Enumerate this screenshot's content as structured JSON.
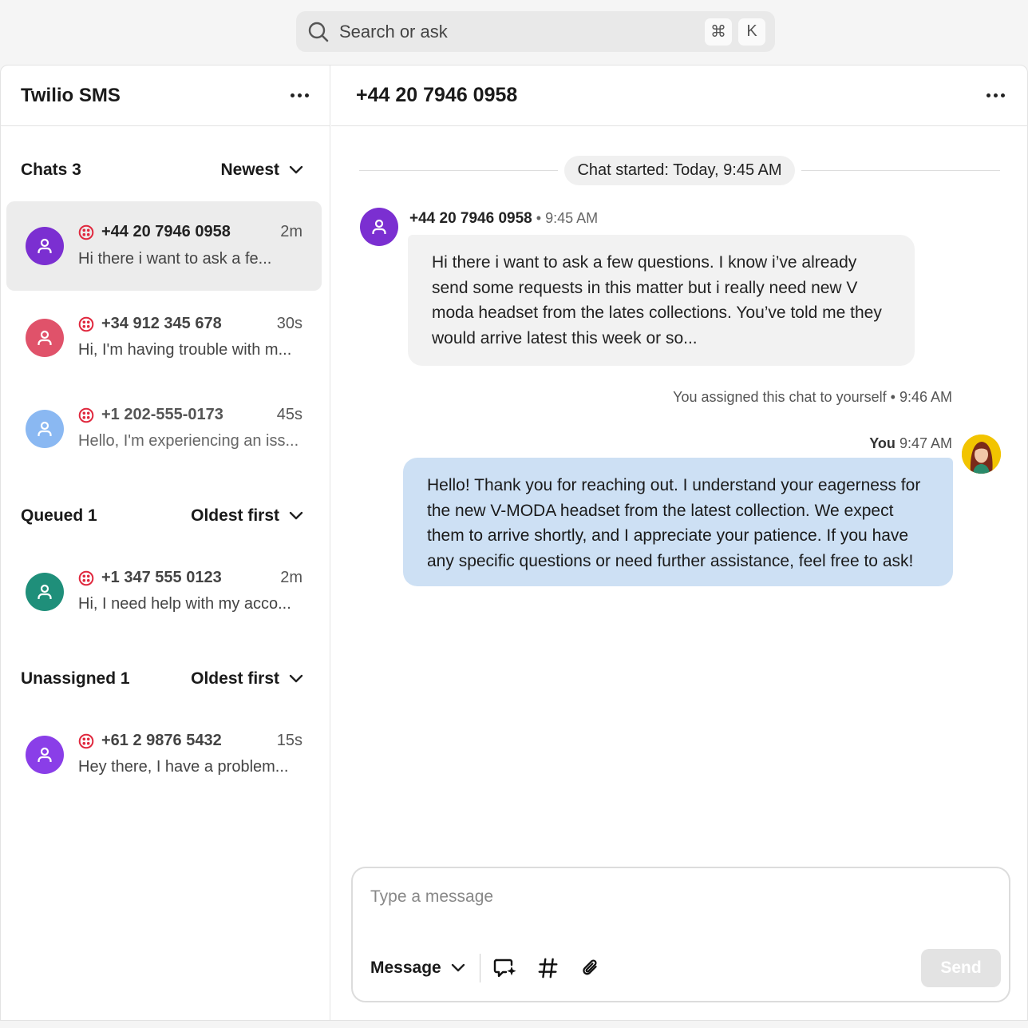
{
  "search": {
    "placeholder": "Search or ask",
    "shortcut_cmd": "⌘",
    "shortcut_key": "K"
  },
  "left_panel": {
    "title": "Twilio SMS",
    "sections": [
      {
        "label": "Chats 3",
        "sort": "Newest",
        "items": [
          {
            "phone": "+44 20 7946 0958",
            "time": "2m",
            "preview": "Hi there i want to ask a fe...",
            "avatar_color": "#7b2fd1",
            "active": true
          },
          {
            "phone": "+34 912 345 678",
            "time": "30s",
            "preview": "Hi, I'm having trouble with m...",
            "avatar_color": "#e0526a"
          },
          {
            "phone": "+1 202-555-0173",
            "time": "45s",
            "preview": "Hello, I'm experiencing an iss...",
            "avatar_color": "#8ab8f2"
          }
        ]
      },
      {
        "label": "Queued 1",
        "sort": "Oldest first",
        "items": [
          {
            "phone": "+1 347 555 0123",
            "time": "2m",
            "preview": "Hi, I need help with my acco...",
            "avatar_color": "#1f8f7a"
          }
        ]
      },
      {
        "label": "Unassigned 1",
        "sort": "Oldest first",
        "items": [
          {
            "phone": "+61 2 9876 5432",
            "time": "15s",
            "preview": "Hey there, I have a problem...",
            "avatar_color": "#8a3ee8"
          }
        ]
      }
    ]
  },
  "conversation": {
    "title": "+44 20 7946 0958",
    "chat_started": "Chat started: Today, 9:45 AM",
    "incoming": {
      "sender": "+44 20 7946 0958",
      "separator": "•",
      "time": "9:45 AM",
      "text": "Hi there i want to ask a few questions. I know i’ve already send some requests in this matter but i really need new V moda headset from the lates collections. You’ve told me they would arrive latest this week or so..."
    },
    "system_note": "You assigned this chat to yourself",
    "system_separator": "•",
    "system_time": "9:46 AM",
    "outgoing": {
      "sender": "You",
      "time": "9:47 AM",
      "text": "Hello! Thank you for reaching out. I understand your eagerness for the new V-MODA headset from the latest collection. We expect them to arrive shortly, and I appreciate your patience. If you have any specific questions or need further assistance, feel free to ask!"
    }
  },
  "composer": {
    "placeholder": "Type a message",
    "type_label": "Message",
    "send_label": "Send"
  },
  "icons": {
    "search": "search-icon",
    "more": "more-horizontal-icon",
    "chevron": "chevron-down-icon",
    "twilio": "twilio-icon",
    "user": "user-icon",
    "ai": "ai-sparkle-icon",
    "hash": "hash-icon",
    "attach": "paperclip-icon"
  }
}
